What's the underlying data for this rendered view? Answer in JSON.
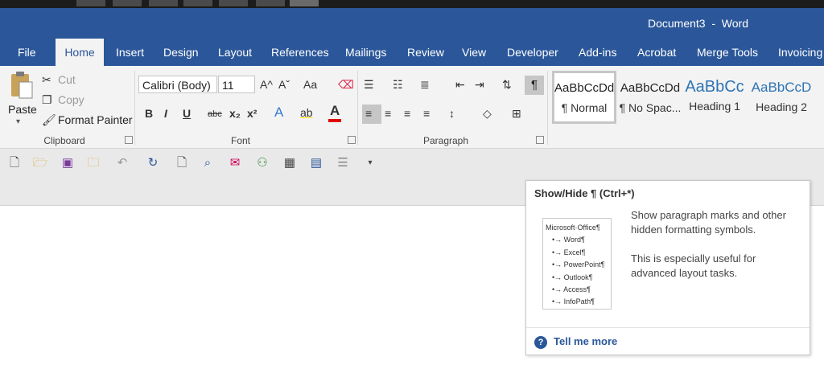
{
  "window": {
    "title": "Document3  -  Word"
  },
  "tabs": [
    {
      "label": "File"
    },
    {
      "label": "Home"
    },
    {
      "label": "Insert"
    },
    {
      "label": "Design"
    },
    {
      "label": "Layout"
    },
    {
      "label": "References"
    },
    {
      "label": "Mailings"
    },
    {
      "label": "Review"
    },
    {
      "label": "View"
    },
    {
      "label": "Developer"
    },
    {
      "label": "Add-ins"
    },
    {
      "label": "Acrobat"
    },
    {
      "label": "Merge Tools"
    },
    {
      "label": "Invoicing"
    }
  ],
  "clipboard": {
    "group_label": "Clipboard",
    "paste": "Paste",
    "cut": "Cut",
    "copy": "Copy",
    "format_painter": "Format Painter"
  },
  "font": {
    "group_label": "Font",
    "font_name": "Calibri (Body)",
    "font_size": "11",
    "bold": "B",
    "italic": "I",
    "underline": "U",
    "strikethrough": "abc",
    "subscript": "x₂",
    "superscript": "x²",
    "change_case": "Aa",
    "text_effects": "A",
    "highlight": "ab",
    "font_color": "A",
    "grow": "A^",
    "shrink": "Aˇ",
    "font_color_swatch": "#e00000"
  },
  "paragraph": {
    "group_label": "Paragraph"
  },
  "styles": [
    {
      "preview": "AaBbCcDd",
      "name": "¶ Normal"
    },
    {
      "preview": "AaBbCcDd",
      "name": "¶ No Spac..."
    },
    {
      "preview": "AaBbCc",
      "name": "Heading 1"
    },
    {
      "preview": "AaBbCcD",
      "name": "Heading 2"
    }
  ],
  "tooltip": {
    "title": "Show/Hide ¶ (Ctrl+*)",
    "preview_lines": [
      "Microsoft·Office¶",
      "•→ Word¶",
      "•→ Excel¶",
      "•→ PowerPoint¶",
      "•→ Outlook¶",
      "•→ Access¶",
      "•→ InfoPath¶"
    ],
    "description": "Show paragraph marks and other hidden formatting symbols.",
    "detail": "This is especially useful for advanced layout tasks.",
    "more_link": "Tell me more",
    "help_icon": "?"
  },
  "qat_icons": [
    "new-doc-icon",
    "open-folder-icon",
    "save-icon",
    "folder-arrow-icon",
    "undo-icon",
    "redo-icon",
    "page-icon",
    "search-icon",
    "envelope-icon",
    "org-chart-icon",
    "table-icon",
    "picture-icon",
    "list-icon",
    "customize-icon"
  ],
  "colors": {
    "accent": "#2b579a",
    "ribbon": "#f3f3f3",
    "qat": "#e9e9e9"
  }
}
